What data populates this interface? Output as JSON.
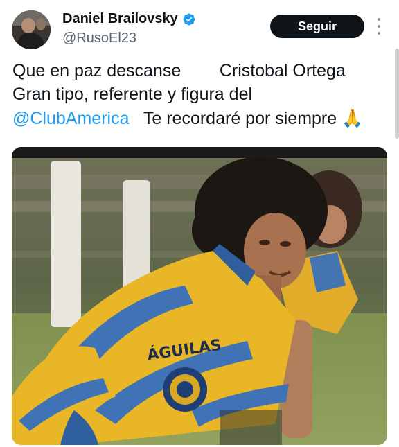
{
  "tweet": {
    "author": {
      "display_name": "Daniel Brailovsky",
      "handle": "@RusoEl23",
      "verified": true,
      "verified_icon": "verified-badge-icon"
    },
    "follow_label": "Seguir",
    "text": {
      "line1_a": "Que en paz descanse",
      "line1_b": "Cristobal Ortega",
      "line2": "Gran tipo, referente y figura del",
      "mention": "@ClubAmerica",
      "line3_rest": "Te recordaré por siempre",
      "emoji": "🙏"
    },
    "photo": {
      "jersey_text": "ÁGUILAS"
    }
  },
  "colors": {
    "link": "#1d9bf0",
    "verified": "#1d9bf0",
    "button_bg": "#0f1419",
    "jersey_yellow": "#e8b627",
    "jersey_blue": "#3f73b5"
  }
}
